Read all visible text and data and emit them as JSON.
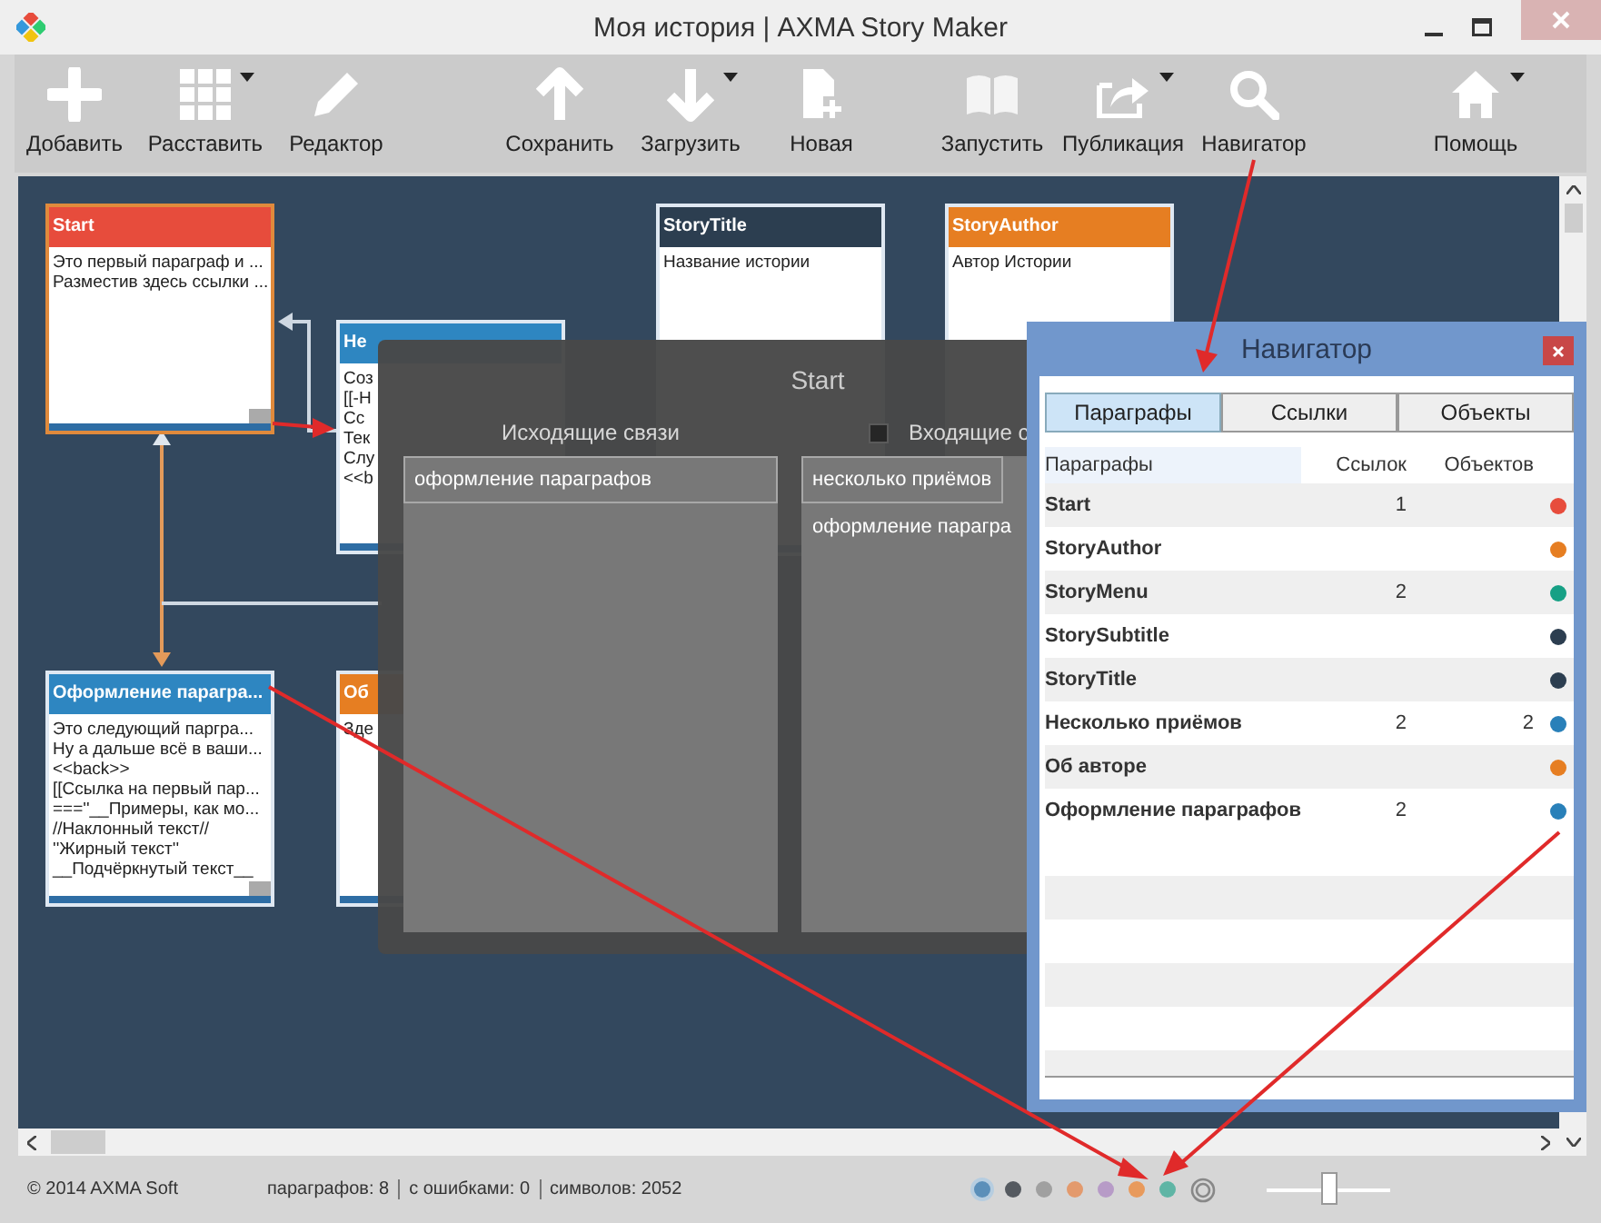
{
  "window": {
    "title": "Моя история | AXMA Story Maker"
  },
  "toolbar": [
    [
      {
        "label": "Добавить",
        "menu": false
      },
      {
        "label": "Расставить",
        "menu": true
      },
      {
        "label": "Редактор",
        "menu": false
      }
    ],
    [
      {
        "label": "Сохранить",
        "menu": false
      },
      {
        "label": "Загрузить",
        "menu": true
      },
      {
        "label": "Новая",
        "menu": false
      }
    ],
    [
      {
        "label": "Запустить",
        "menu": false
      },
      {
        "label": "Публикация",
        "menu": true
      },
      {
        "label": "Навигатор",
        "menu": false
      }
    ],
    [
      {
        "label": "Помощь",
        "menu": true
      }
    ]
  ],
  "cards": [
    {
      "title": "Start",
      "color": "#e74c3c",
      "selected": true,
      "lines": [
        "Это первый параграф и ...",
        "Разместив здесь ссылки ..."
      ]
    },
    {
      "title": "StoryTitle",
      "color": "#2c3e50",
      "selected": false,
      "lines": [
        "Название истории"
      ]
    },
    {
      "title": "StoryAuthor",
      "color": "#e67e22",
      "selected": false,
      "lines": [
        "Автор Истории"
      ]
    },
    {
      "title": "Не",
      "color": "#2e86c1",
      "selected": false,
      "lines": [
        "Соз",
        "[[-Н",
        "Сс",
        "Тек",
        "Слу",
        "<<b"
      ]
    },
    {
      "title": "Оформление парагра...",
      "color": "#2e86c1",
      "selected": false,
      "lines": [
        "Это следующий паргра...",
        "Ну а дальше всё в ваши...",
        "<<back>>",
        "[[Ссылка на первый пар...",
        "===''__Примеры, как мо...",
        "//Наклонный текст//",
        "''Жирный текст''",
        "__Подчёркнутый текст__"
      ]
    },
    {
      "title": "Об",
      "color": "#e67e22",
      "selected": false,
      "lines": [
        "Зде"
      ]
    }
  ],
  "dialog": {
    "title": "Start",
    "outgoing_label": "Исходящие связи",
    "incoming_label": "Входящие с",
    "outgoing": [
      {
        "text": "оформление параграфов",
        "selected": true
      }
    ],
    "incoming": [
      {
        "text": "несколько приёмов",
        "selected": true
      },
      {
        "text": "оформление парагра",
        "selected": false
      }
    ]
  },
  "navigator": {
    "title": "Навигатор",
    "tabs": [
      {
        "label": "Параграфы",
        "selected": true
      },
      {
        "label": "Ссылки",
        "selected": false
      },
      {
        "label": "Объекты",
        "selected": false
      }
    ],
    "columns": [
      "Параграфы",
      "Ссылок",
      "Объектов"
    ],
    "rows": [
      {
        "name": "Start",
        "links": "1",
        "color": "#e74c3c"
      },
      {
        "name": "StoryAuthor",
        "color": "#e67e22"
      },
      {
        "name": "StoryMenu",
        "links": "2",
        "color": "#16a085"
      },
      {
        "name": "StorySubtitle",
        "color": "#2c3e50"
      },
      {
        "name": "StoryTitle",
        "color": "#2c3e50"
      },
      {
        "name": "Несколько приёмов",
        "links": "2",
        "objects": "2",
        "color": "#2980b9"
      },
      {
        "name": "Об авторе",
        "color": "#e67e22"
      },
      {
        "name": "Оформление параграфов",
        "links": "2",
        "color": "#2980b9"
      }
    ]
  },
  "status": {
    "copyright": "© 2014 AXMA Soft",
    "stats": [
      "параграфов: 8",
      "с ошибками: 0",
      "символов: 2052"
    ],
    "dots": [
      {
        "color": "#5b8fb9",
        "selected": true
      },
      {
        "color": "#555a60",
        "selected": false
      },
      {
        "color": "#a0a0a0",
        "selected": false
      },
      {
        "color": "#e39a6d",
        "selected": false
      },
      {
        "color": "#b79bc7",
        "selected": false
      },
      {
        "color": "#e89a5c",
        "selected": false
      },
      {
        "color": "#5fb5a5",
        "selected": false
      }
    ],
    "zoom": {
      "level": 0.5
    }
  }
}
